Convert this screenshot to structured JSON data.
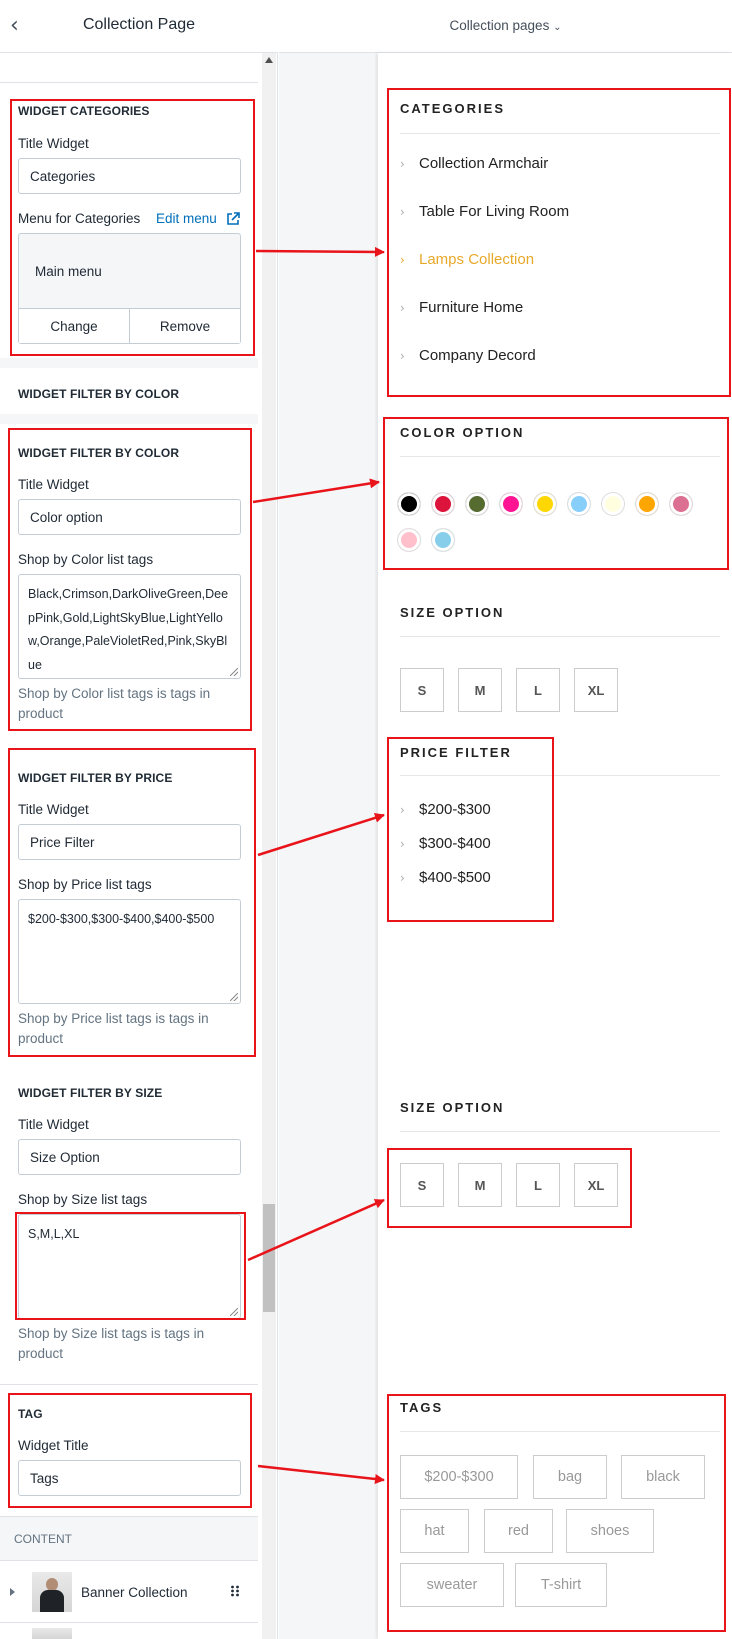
{
  "header": {
    "back_icon": "chevron-left-icon",
    "title": "Collection Page",
    "page_selector": "Collection pages"
  },
  "sections": {
    "categories": {
      "heading": "WIDGET CATEGORIES",
      "title_label": "Title Widget",
      "title_value": "Categories",
      "menu_label": "Menu for Categories",
      "edit_menu": "Edit menu",
      "menu_value": "Main menu",
      "change": "Change",
      "remove": "Remove"
    },
    "collapsed_color": {
      "heading": "WIDGET FILTER BY COLOR"
    },
    "color": {
      "heading": "WIDGET FILTER BY COLOR",
      "title_label": "Title Widget",
      "title_value": "Color option",
      "tags_label": "Shop by Color list tags",
      "tags_value": "Black,Crimson,DarkOliveGreen,DeepPink,Gold,LightSkyBlue,LightYellow,Orange,PaleVioletRed,Pink,SkyBlue",
      "help": "Shop by Color list tags is tags in product"
    },
    "price": {
      "heading": "WIDGET FILTER BY PRICE",
      "title_label": "Title Widget",
      "title_value": "Price Filter",
      "tags_label": "Shop by Price list tags",
      "tags_value": "$200-$300,$300-$400,$400-$500",
      "help": "Shop by Price list tags is tags in product"
    },
    "size": {
      "heading": "WIDGET FILTER BY SIZE",
      "title_label": "Title Widget",
      "title_value": "Size Option",
      "tags_label": "Shop by Size list tags",
      "tags_value": "S,M,L,XL",
      "help": "Shop by Size list tags is tags in product"
    },
    "tag": {
      "heading": "TAG",
      "title_label": "Widget Title",
      "title_value": "Tags"
    },
    "content": {
      "heading": "CONTENT",
      "item": "Banner Collection",
      "drag_icon": "drag-handle-icon"
    }
  },
  "preview": {
    "categories_title": "CATEGORIES",
    "categories": [
      "Collection Armchair",
      "Table For Living Room",
      "Lamps Collection",
      "Furniture Home",
      "Company Decord"
    ],
    "active_category_color": "#e8a92a",
    "color_title": "COLOR OPTION",
    "colors": [
      "#000000",
      "#dc143c",
      "#556b2f",
      "#ff1493",
      "#ffd700",
      "#87cefa",
      "#ffffe0",
      "#ffa500",
      "#db7093",
      "#ffc0cb",
      "#87ceeb"
    ],
    "size_title_1": "SIZE OPTION",
    "sizes": [
      "S",
      "M",
      "L",
      "XL"
    ],
    "price_title": "PRICE FILTER",
    "prices": [
      "$200-$300",
      "$300-$400",
      "$400-$500"
    ],
    "size_title_2": "SIZE OPTION",
    "tags_title": "TAGS",
    "tags": [
      "$200-$300",
      "bag",
      "black",
      "hat",
      "red",
      "shoes",
      "sweater",
      "T-shirt"
    ]
  },
  "annotation_color": "#e8141a"
}
